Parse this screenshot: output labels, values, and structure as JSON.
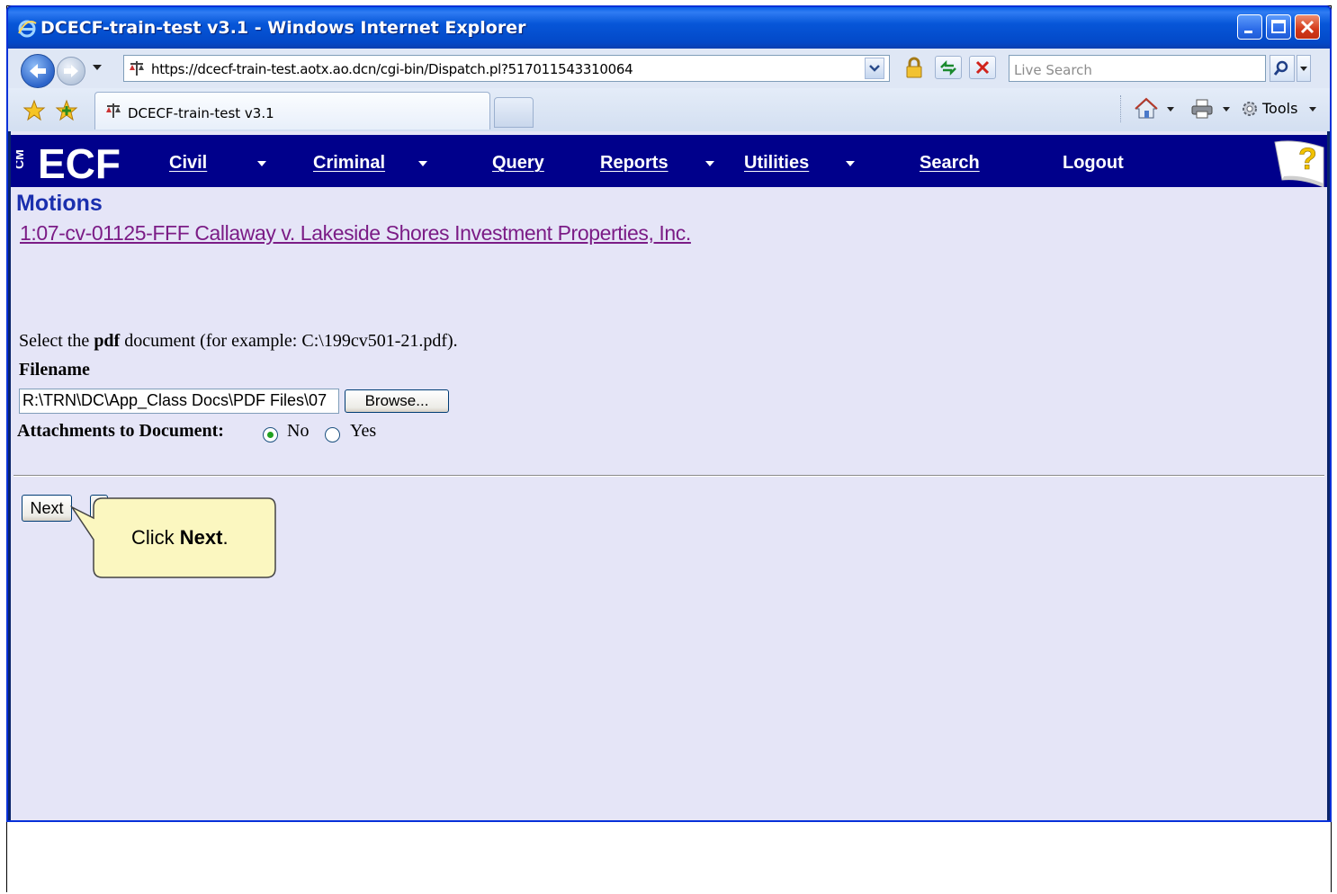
{
  "window": {
    "title": "DCECF-train-test v3.1 - Windows Internet Explorer"
  },
  "browser": {
    "address": "https://dcecf-train-test.aotx.ao.dcn/cgi-bin/Dispatch.pl?517011543310064",
    "search_placeholder": "Live Search",
    "tab_label": "DCECF-train-test v3.1",
    "tools_label": "Tools"
  },
  "nav": {
    "logo": "ECF",
    "logo_prefix": "CM",
    "items": [
      {
        "label": "Civil",
        "dropdown": true
      },
      {
        "label": "Criminal",
        "dropdown": true
      },
      {
        "label": "Query",
        "dropdown": false
      },
      {
        "label": "Reports",
        "dropdown": true
      },
      {
        "label": "Utilities",
        "dropdown": true
      },
      {
        "label": "Search",
        "dropdown": false
      },
      {
        "label": "Logout",
        "dropdown": false
      }
    ]
  },
  "page": {
    "title": "Motions",
    "case_link": "1:07-cv-01125-FFF Callaway v. Lakeside Shores Investment Properties, Inc.",
    "instruction_pre": "Select the ",
    "instruction_bold": "pdf",
    "instruction_post": " document (for example: C:\\199cv501-21.pdf).",
    "filename_label": "Filename",
    "filename_value": "R:\\TRN\\DC\\App_Class Docs\\PDF Files\\07",
    "browse_label": "Browse...",
    "attachments_label": "Attachments to Document:",
    "radio_no": "No",
    "radio_yes": "Yes",
    "attachments_selected": "No",
    "next_label": "Next"
  },
  "callout": {
    "text_pre": "Click ",
    "text_bold": "Next",
    "text_post": "."
  },
  "colors": {
    "nav_bg": "#00008b",
    "content_bg": "#e5e5f7",
    "title_color": "#1a2fae",
    "link_color": "#7b1c86",
    "callout_bg": "#fbf7c0"
  }
}
